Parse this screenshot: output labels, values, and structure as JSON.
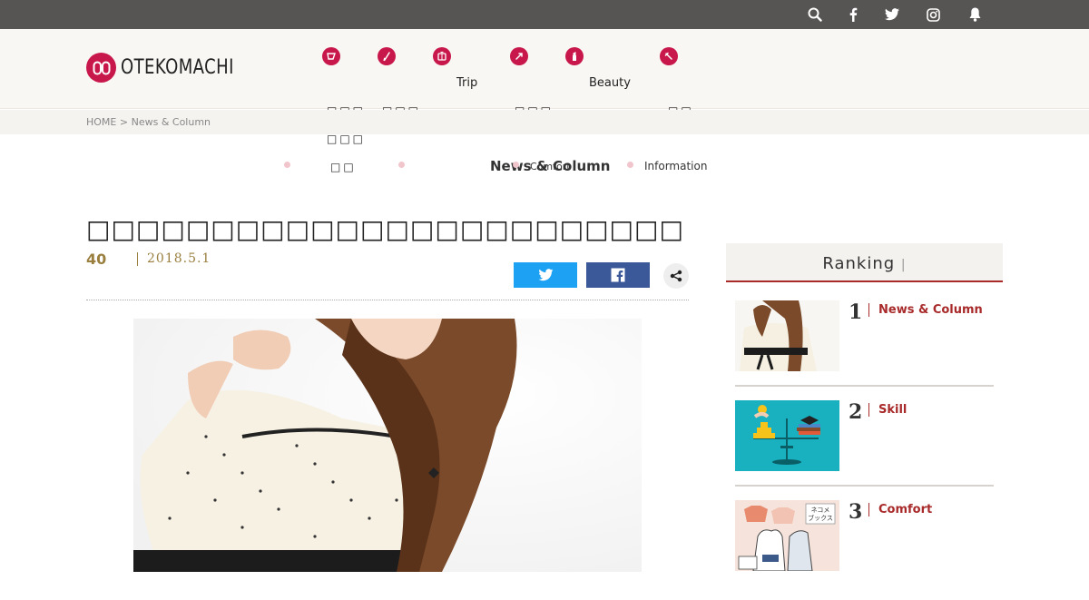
{
  "topbar": {
    "icons": [
      "search-icon",
      "facebook-icon",
      "twitter-icon",
      "instagram-icon",
      "bell-icon"
    ]
  },
  "header": {
    "logo_text": "OTEKOMACHI",
    "nav": [
      {
        "icon": "news-icon",
        "label": ""
      },
      {
        "icon": "pen-icon",
        "label": ""
      },
      {
        "icon": "trip-icon",
        "label": "Trip"
      },
      {
        "icon": "comfort-icon",
        "label": ""
      },
      {
        "icon": "beauty-icon",
        "label": "Beauty"
      },
      {
        "icon": "info-icon",
        "label": ""
      }
    ]
  },
  "breadcrumb": {
    "home": "HOME",
    "separator": ">",
    "current": "News & Column"
  },
  "subnav": {
    "active": "News & Column",
    "overlap_label": "Comfort",
    "information": "Information"
  },
  "article": {
    "number": "40",
    "date": "2018.5.1"
  },
  "ranking": {
    "title": "Ranking",
    "items": [
      {
        "rank": "1",
        "category": "News & Column"
      },
      {
        "rank": "2",
        "category": "Skill"
      },
      {
        "rank": "3",
        "category": "Comfort"
      }
    ]
  },
  "colors": {
    "accent": "#c8174a",
    "ranking_red": "#a82a2a",
    "gold": "#9a7f3e",
    "twitter": "#1da1f2",
    "facebook": "#3b5998",
    "topbar": "#575553"
  }
}
